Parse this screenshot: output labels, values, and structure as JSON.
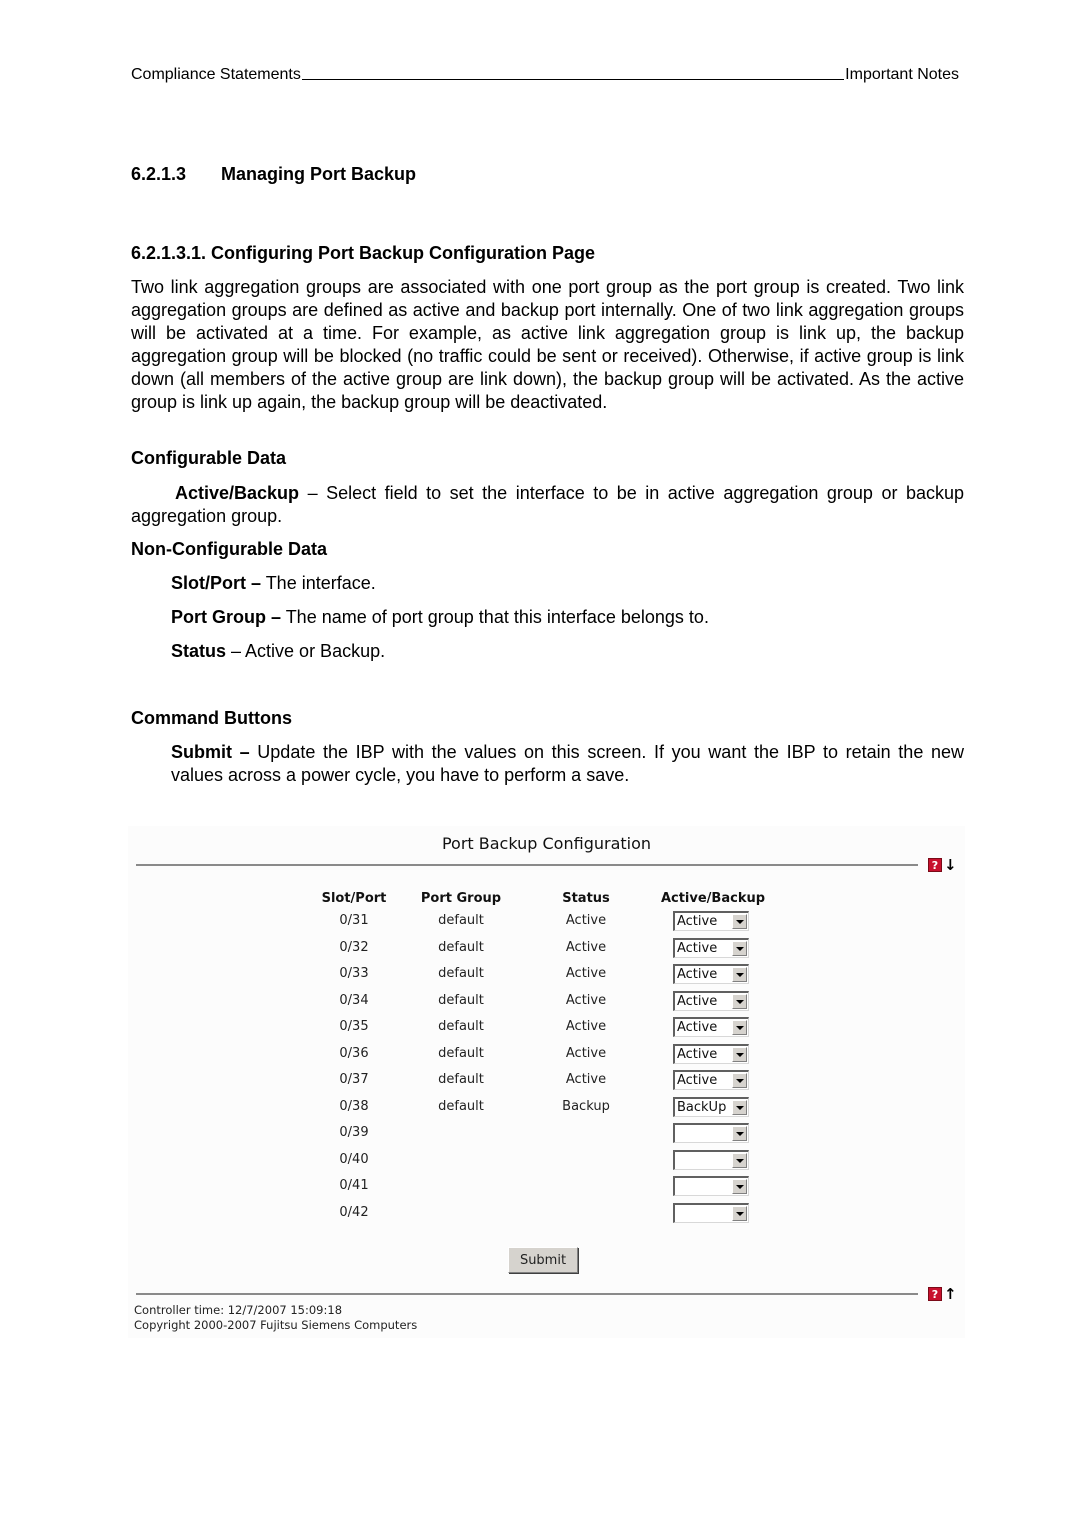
{
  "page_header": {
    "left": "Compliance Statements",
    "right": "Important Notes"
  },
  "section": {
    "number": "6.2.1.3",
    "title": "Managing Port Backup"
  },
  "subsection": {
    "title": "6.2.1.3.1. Configuring Port Backup Configuration Page"
  },
  "intro": "Two link aggregation groups are associated with one port group as the port group is created. Two link aggregation groups are defined as active and backup port internally. One of two link aggregation groups will be activated at a time. For example, as active link aggregation group is link up, the backup aggregation group will be blocked (no traffic could be sent or received). Otherwise, if active group is link down (all members of the active group are link down), the backup group will be activated. As the active group is link up again, the backup group will be deactivated.",
  "configurable": {
    "heading": "Configurable Data",
    "items": [
      {
        "term": "Active/Backup",
        "desc": " – Select field to set the interface to be in active aggregation group or backup aggregation group."
      }
    ]
  },
  "non_configurable": {
    "heading": "Non-Configurable Data",
    "items": [
      {
        "term": "Slot/Port –",
        "desc": " The interface."
      },
      {
        "term": "Port Group –",
        "desc": " The name of port group that this interface belongs to."
      },
      {
        "term": "Status",
        "desc": " – Active or Backup."
      }
    ]
  },
  "command_buttons": {
    "heading": "Command Buttons",
    "items": [
      {
        "term": "Submit –",
        "desc": " Update the IBP with the values on this screen. If you want the IBP to retain the new values across a power cycle, you have to perform a save."
      }
    ]
  },
  "screenshot": {
    "title": "Port Backup Configuration",
    "help_icon": "?",
    "scroll_down_icon": "↓",
    "scroll_up_icon": "↑",
    "columns": [
      "Slot/Port",
      "Port Group",
      "Status",
      "Active/Backup"
    ],
    "rows": [
      {
        "slot_port": "0/31",
        "port_group": "default",
        "status": "Active",
        "active_backup": "Active"
      },
      {
        "slot_port": "0/32",
        "port_group": "default",
        "status": "Active",
        "active_backup": "Active"
      },
      {
        "slot_port": "0/33",
        "port_group": "default",
        "status": "Active",
        "active_backup": "Active"
      },
      {
        "slot_port": "0/34",
        "port_group": "default",
        "status": "Active",
        "active_backup": "Active"
      },
      {
        "slot_port": "0/35",
        "port_group": "default",
        "status": "Active",
        "active_backup": "Active"
      },
      {
        "slot_port": "0/36",
        "port_group": "default",
        "status": "Active",
        "active_backup": "Active"
      },
      {
        "slot_port": "0/37",
        "port_group": "default",
        "status": "Active",
        "active_backup": "Active"
      },
      {
        "slot_port": "0/38",
        "port_group": "default",
        "status": "Backup",
        "active_backup": "BackUp"
      },
      {
        "slot_port": "0/39",
        "port_group": "",
        "status": "",
        "active_backup": ""
      },
      {
        "slot_port": "0/40",
        "port_group": "",
        "status": "",
        "active_backup": ""
      },
      {
        "slot_port": "0/41",
        "port_group": "",
        "status": "",
        "active_backup": ""
      },
      {
        "slot_port": "0/42",
        "port_group": "",
        "status": "",
        "active_backup": ""
      }
    ],
    "submit_label": "Submit",
    "controller_time": "Controller time: 12/7/2007 15:09:18",
    "copyright": "Copyright 2000-2007 Fujitsu Siemens Computers",
    "colors": {
      "help_icon_bg": "#c8102e",
      "rule": "#8a8a8a",
      "button_face": "#d6d3ce"
    }
  }
}
